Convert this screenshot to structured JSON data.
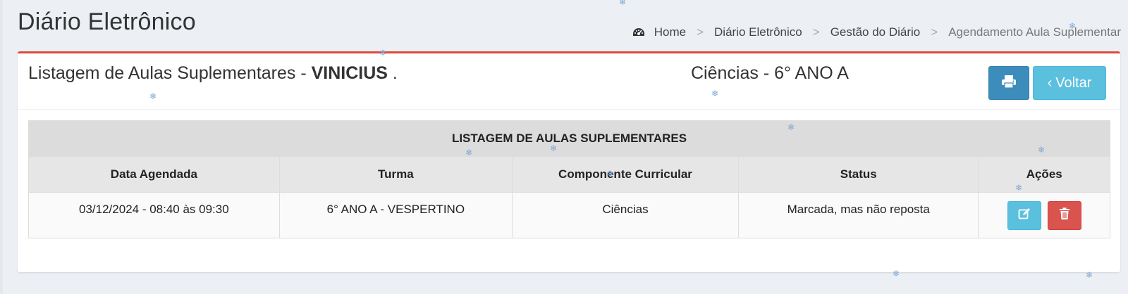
{
  "page": {
    "title": "Diário Eletrônico"
  },
  "breadcrumb": {
    "items": [
      "Home",
      "Diário Eletrônico",
      "Gestão do Diário",
      "Agendamento Aula Suplementar"
    ],
    "separator": ">",
    "home_icon": "dashboard-icon"
  },
  "box": {
    "title_prefix": "Listagem de Aulas Suplementares - ",
    "teacher": "VINICIUS",
    "title_suffix": " .",
    "subject": "Ciências - 6° ANO A",
    "print_icon": "print-icon",
    "back_label": "Voltar",
    "back_icon": "chevron-left-icon"
  },
  "table": {
    "caption": "LISTAGEM DE AULAS SUPLEMENTARES",
    "headers": [
      "Data Agendada",
      "Turma",
      "Componente Curricular",
      "Status",
      "Ações"
    ],
    "rows": [
      {
        "date": "03/12/2024 - 08:40 às 09:30",
        "turma": "6° ANO A - VESPERTINO",
        "componente": "Ciências",
        "status": "Marcada, mas não reposta",
        "actions": [
          "edit-icon",
          "trash-icon"
        ]
      }
    ]
  },
  "colors": {
    "accent_red": "#dd4b39",
    "primary_blue": "#3c8dbc",
    "info_cyan": "#5bc0de",
    "danger_red": "#d9534f",
    "background": "#ecf0f5"
  }
}
